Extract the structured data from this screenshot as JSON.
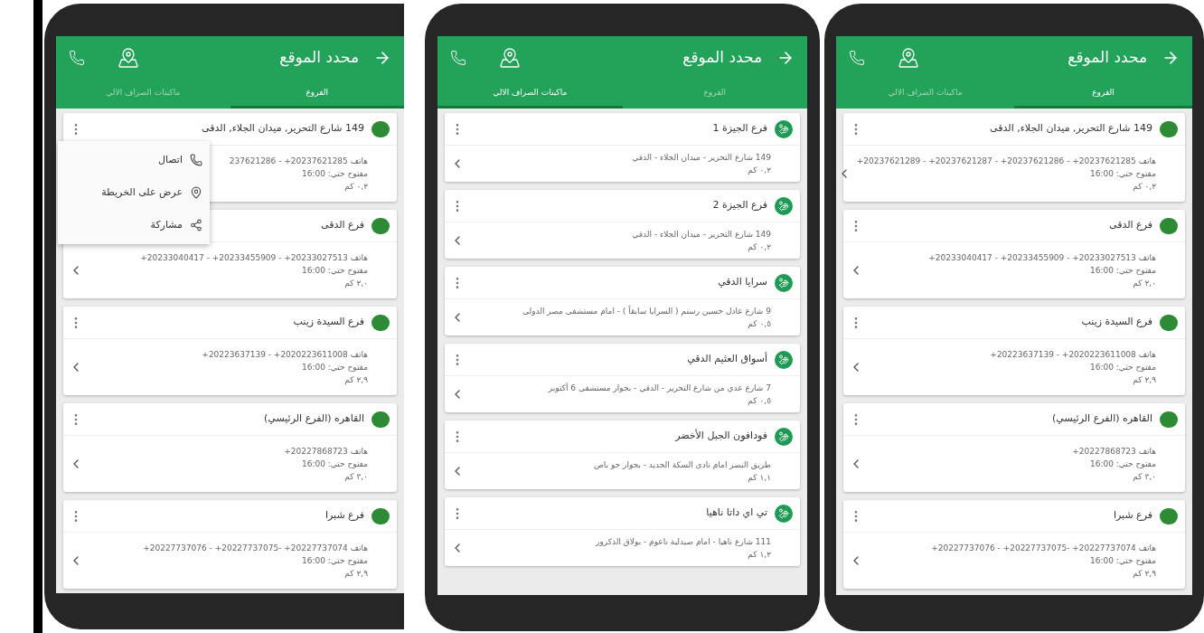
{
  "phones": [
    {
      "title": "محدد الموقع",
      "tabs": [
        {
          "label": "الفروع",
          "selected": true
        },
        {
          "label": "ماكينات الصراف الالي",
          "selected": false
        }
      ],
      "cards": [
        {
          "kind": "branch",
          "title": "149 شارع التحرير, ميدان الجلاء, الدقى",
          "menu_open": false,
          "lines": [
            {
              "kind": "phone",
              "text": "+20237621289 - +20237621287 - +20237621286 - +20237621285 هاتف"
            },
            {
              "kind": "text",
              "text": "مفتوح حتي: 16:00"
            },
            {
              "kind": "text",
              "text": "٠,٢ كم"
            }
          ]
        },
        {
          "kind": "branch",
          "title": "فرع الدقى",
          "menu_open": false,
          "lines": [
            {
              "kind": "phone",
              "text": "+20233040417 - +20233455909 - +20233027513 هاتف"
            },
            {
              "kind": "text",
              "text": "مفتوح حتي: 16:00"
            },
            {
              "kind": "text",
              "text": "٢,٠ كم"
            }
          ]
        },
        {
          "kind": "branch",
          "title": "فرع السيدة زينب",
          "menu_open": false,
          "lines": [
            {
              "kind": "phone",
              "text": "+20223637139 - +2020223611008 هاتف"
            },
            {
              "kind": "text",
              "text": "مفتوح حتي: 16:00"
            },
            {
              "kind": "text",
              "text": "٢,٩ كم"
            }
          ]
        },
        {
          "kind": "branch",
          "title": "القاهره (الفرع الرئيسي)",
          "menu_open": false,
          "lines": [
            {
              "kind": "phone",
              "text": "+20227868723 هاتف"
            },
            {
              "kind": "text",
              "text": "مفتوح حتي: 16:00"
            },
            {
              "kind": "text",
              "text": "٣,٠ كم"
            }
          ]
        },
        {
          "kind": "branch",
          "title": "فرع شبرا",
          "menu_open": false,
          "lines": [
            {
              "kind": "phone",
              "text": "+20227737076 - +20227737075- +20227737074 هاتف"
            },
            {
              "kind": "text",
              "text": "مفتوح حتي: 16:00"
            },
            {
              "kind": "text",
              "text": "٢,٩ كم"
            }
          ]
        }
      ]
    },
    {
      "title": "محدد الموقع",
      "tabs": [
        {
          "label": "الفروع",
          "selected": false
        },
        {
          "label": "ماكينات الصراف الالي",
          "selected": true
        }
      ],
      "cards": [
        {
          "kind": "atm",
          "title": "فرع الجيزة 1",
          "menu_open": false,
          "lines": [
            {
              "kind": "text",
              "text": "149 شارع التحرير - ميدان الجلاء - الدقي"
            },
            {
              "kind": "text",
              "text": "٠,٢ كم"
            }
          ]
        },
        {
          "kind": "atm",
          "title": "فرع الجيزة 2",
          "menu_open": false,
          "lines": [
            {
              "kind": "text",
              "text": "149 شارع التحرير - ميدان الجلاء - الدقي"
            },
            {
              "kind": "text",
              "text": "٠,٢ كم"
            }
          ]
        },
        {
          "kind": "atm",
          "title": "سرايا الدقي",
          "menu_open": false,
          "lines": [
            {
              "kind": "text",
              "text": "9 شارع عادل حسين رستم ( السرايا سابقاً ) - امام مستشفى مصر الدولى"
            },
            {
              "kind": "text",
              "text": "٠,٥ كم"
            }
          ]
        },
        {
          "kind": "atm",
          "title": "أسواق العثيم الدقي",
          "menu_open": false,
          "lines": [
            {
              "kind": "text",
              "text": "7 شارع عدي من شارع التحرير - الدقي - بجوار مستشفى 6 أكتوبر"
            },
            {
              "kind": "text",
              "text": "٠,٥ كم"
            }
          ]
        },
        {
          "kind": "atm",
          "title": "فودافون الجبل الأخضر",
          "menu_open": false,
          "lines": [
            {
              "kind": "text",
              "text": "طريق النصر امام نادي السكة الحديد - بجوار جو باص"
            },
            {
              "kind": "text",
              "text": "١,١ كم"
            }
          ]
        },
        {
          "kind": "atm",
          "title": "تي اي داتا ناهيا",
          "menu_open": false,
          "lines": [
            {
              "kind": "text",
              "text": "111 شارع ناهيا - امام صيدلية ناعوم - بولاق الدكرور"
            },
            {
              "kind": "text",
              "text": "١,٢ كم"
            }
          ]
        }
      ]
    },
    {
      "title": "محدد الموقع",
      "tabs": [
        {
          "label": "الفروع",
          "selected": true
        },
        {
          "label": "ماكينات الصراف الالي",
          "selected": false
        }
      ],
      "cards": [
        {
          "kind": "branch",
          "title": "149 شارع التحرير, ميدان الجلاء, الدقى",
          "menu_open": true,
          "lines": [
            {
              "kind": "phone",
              "text": "237621286 - +20237621285 هاتف"
            },
            {
              "kind": "text",
              "text": "مفتوح حتي: 16:00"
            },
            {
              "kind": "text",
              "text": "٠,٢ كم"
            }
          ]
        },
        {
          "kind": "branch",
          "title": "فرع الدقى",
          "menu_open": false,
          "lines": [
            {
              "kind": "phone",
              "text": "+20233040417 - +20233455909 - +20233027513 هاتف"
            },
            {
              "kind": "text",
              "text": "مفتوح حتي: 16:00"
            },
            {
              "kind": "text",
              "text": "٢,٠ كم"
            }
          ]
        },
        {
          "kind": "branch",
          "title": "فرع السيدة زينب",
          "menu_open": false,
          "lines": [
            {
              "kind": "phone",
              "text": "+20223637139 - +2020223611008 هاتف"
            },
            {
              "kind": "text",
              "text": "مفتوح حتي: 16:00"
            },
            {
              "kind": "text",
              "text": "٢,٩ كم"
            }
          ]
        },
        {
          "kind": "branch",
          "title": "القاهره (الفرع الرئيسي)",
          "menu_open": false,
          "lines": [
            {
              "kind": "phone",
              "text": "+20227868723 هاتف"
            },
            {
              "kind": "text",
              "text": "مفتوح حتي: 16:00"
            },
            {
              "kind": "text",
              "text": "٣,٠ كم"
            }
          ]
        },
        {
          "kind": "branch",
          "title": "فرع شبرا",
          "menu_open": false,
          "lines": [
            {
              "kind": "phone",
              "text": "+20227737076 - +20227737075- +20227737074 هاتف"
            },
            {
              "kind": "text",
              "text": "مفتوح حتي: 16:00"
            },
            {
              "kind": "text",
              "text": "٢,٩ كم"
            }
          ]
        }
      ],
      "menu": {
        "items": [
          {
            "kind": "call",
            "label": "اتصال"
          },
          {
            "kind": "map",
            "label": "عرض على الخريطة"
          },
          {
            "kind": "share",
            "label": "مشاركة"
          }
        ]
      }
    }
  ]
}
